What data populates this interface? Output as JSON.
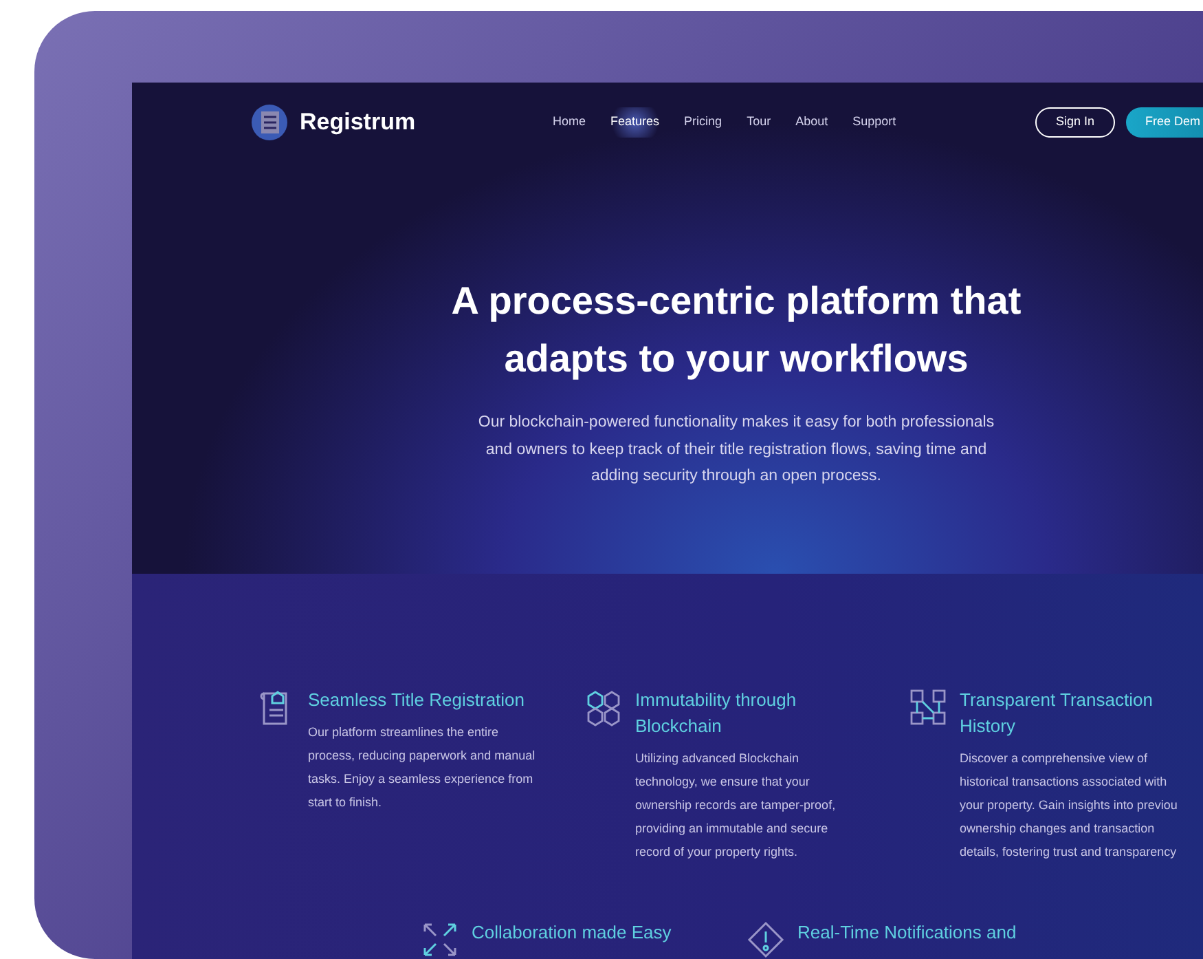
{
  "brand": {
    "name": "Registrum"
  },
  "nav": [
    {
      "label": "Home",
      "selected": false
    },
    {
      "label": "Features",
      "selected": true
    },
    {
      "label": "Pricing",
      "selected": false
    },
    {
      "label": "Tour",
      "selected": false
    },
    {
      "label": "About",
      "selected": false
    },
    {
      "label": "Support",
      "selected": false
    }
  ],
  "actions": [
    {
      "label": "Sign In",
      "kind": "outline"
    },
    {
      "label": "Free Dem",
      "kind": "filled"
    }
  ],
  "hero": {
    "title_lines": [
      "A process-centric platform that",
      "adapts to your workflows"
    ],
    "subtitle_lines": [
      "Our blockchain-powered functionality makes it easy for both professionals",
      "and owners to keep track of their title registration flows, saving time and",
      "adding security through an open process."
    ]
  },
  "features": [
    {
      "kind": "document",
      "title": "Seamless Title Registration",
      "description_lines": [
        "Our platform streamlines the entire",
        "process, reducing paperwork and manual",
        "tasks. Enjoy a seamless experience from",
        "start to finish."
      ]
    },
    {
      "kind": "cubes",
      "title": "Immutability through Blockchain",
      "description_lines": [
        "Utilizing advanced Blockchain",
        "technology, we ensure that your",
        "ownership records are tamper-proof,",
        "providing an immutable and secure",
        "record of your property rights."
      ]
    },
    {
      "kind": "flow",
      "title": "Transparent Transaction History",
      "description_lines": [
        "Discover a comprehensive view of",
        "historical transactions associated with",
        "your property. Gain insights into previou",
        "ownership changes and transaction",
        "details, fostering trust and transparency"
      ]
    },
    {
      "kind": "arrows",
      "title": "Collaboration made Easy"
    },
    {
      "kind": "alert",
      "title": "Real-Time Notifications and"
    }
  ]
}
